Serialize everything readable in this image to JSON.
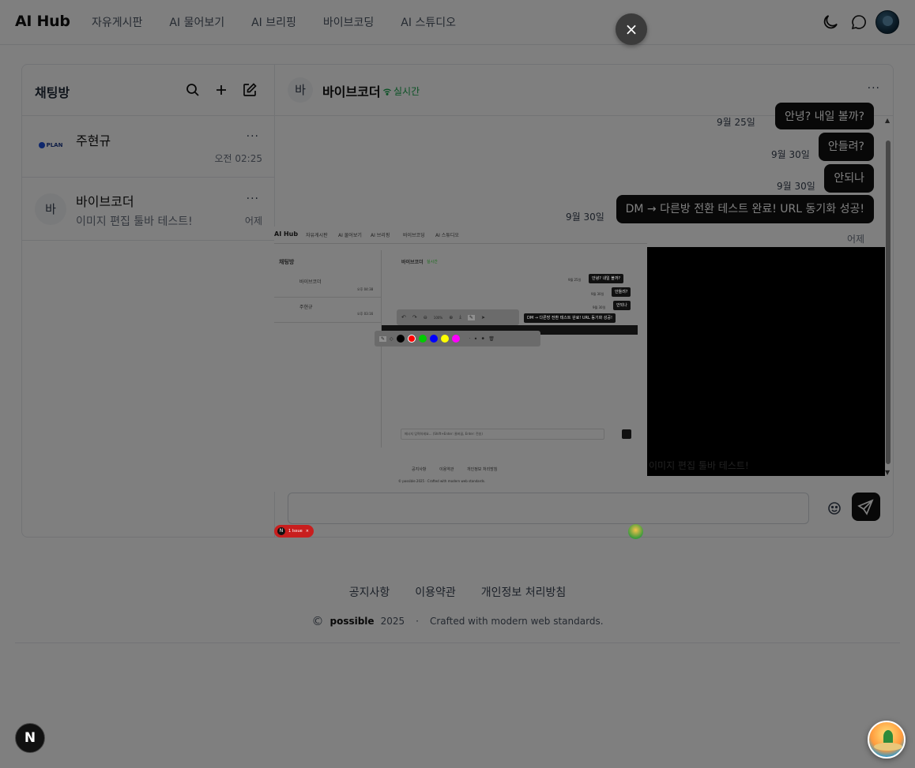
{
  "nav": {
    "logo": "AI Hub",
    "links": [
      "자유게시판",
      "AI 물어보기",
      "AI 브리핑",
      "바이브코딩",
      "AI 스튜디오"
    ]
  },
  "sidebar": {
    "title": "채팅방",
    "rooms": [
      {
        "name": "주현규",
        "avatar_text": "PLAN",
        "last_message": "",
        "time": "오전 02:25",
        "more": "···"
      },
      {
        "name": "바이브코더",
        "avatar_text": "바",
        "last_message": "이미지 편집 툴바 테스트!",
        "time": "어제",
        "more": "···"
      }
    ]
  },
  "chat": {
    "avatar_text": "바",
    "title": "바이브코더",
    "status": "실시간",
    "more": "···",
    "messages": [
      {
        "date": "9월 25일",
        "text": "안녕? 내일 볼까?"
      },
      {
        "date": "9월 30일",
        "text": "안들려?"
      },
      {
        "date": "9월 30일",
        "text": "안되나"
      },
      {
        "date": "9월 30일",
        "text": "DM → 다른방 전환 테스트 완료! URL 동기화 성공!"
      }
    ],
    "day_label": "어제",
    "image_caption": "이미지 편집 툴바 테스트!"
  },
  "footer": {
    "links": [
      "공지사항",
      "이용약관",
      "개인정보 처리방침"
    ],
    "copyright_symbol": "©",
    "brand": "possible",
    "year": "2025",
    "separator": "·",
    "tagline": "Crafted with modern web standards."
  },
  "overlay": {
    "close_label": "×",
    "preview": {
      "logo": "AI Hub",
      "links": [
        "자유게시판",
        "AI 물어보기",
        "AI 브리핑",
        "바이브코딩",
        "AI 스튜디오"
      ],
      "sidebar_title": "채팅방",
      "rooms": [
        {
          "name": "바이브코더",
          "time": "오후 04:38"
        },
        {
          "name": "주현규",
          "time": "오후 03:16"
        }
      ],
      "chat_title": "바이브코더",
      "status": "실시간",
      "messages": [
        {
          "date": "9월 25일",
          "text": "안녕? 내일 볼까?"
        },
        {
          "date": "9월 30일",
          "text": "안들려?"
        },
        {
          "date": "9월 30일",
          "text": "안되나"
        },
        {
          "date": "",
          "text": "DM → 다른방 전환 테스트 완료! URL 동기화 성공!"
        }
      ],
      "zoom": "100%",
      "input_placeholder": "메시지 입력하세요... (Shift+Enter: 줄바꿈, Enter: 전송)",
      "footer_links": [
        "공지사항",
        "이용약관",
        "개인정보 처리방침"
      ],
      "footer_copy": "© possible 2025 · Crafted with modern web standards.",
      "badge": "1 Issue",
      "colors": [
        "#000000",
        "#ff0000",
        "#00cc00",
        "#0000ff",
        "#ffff00",
        "#ff00ff"
      ]
    }
  },
  "floating": {
    "dev_badge": "N"
  }
}
